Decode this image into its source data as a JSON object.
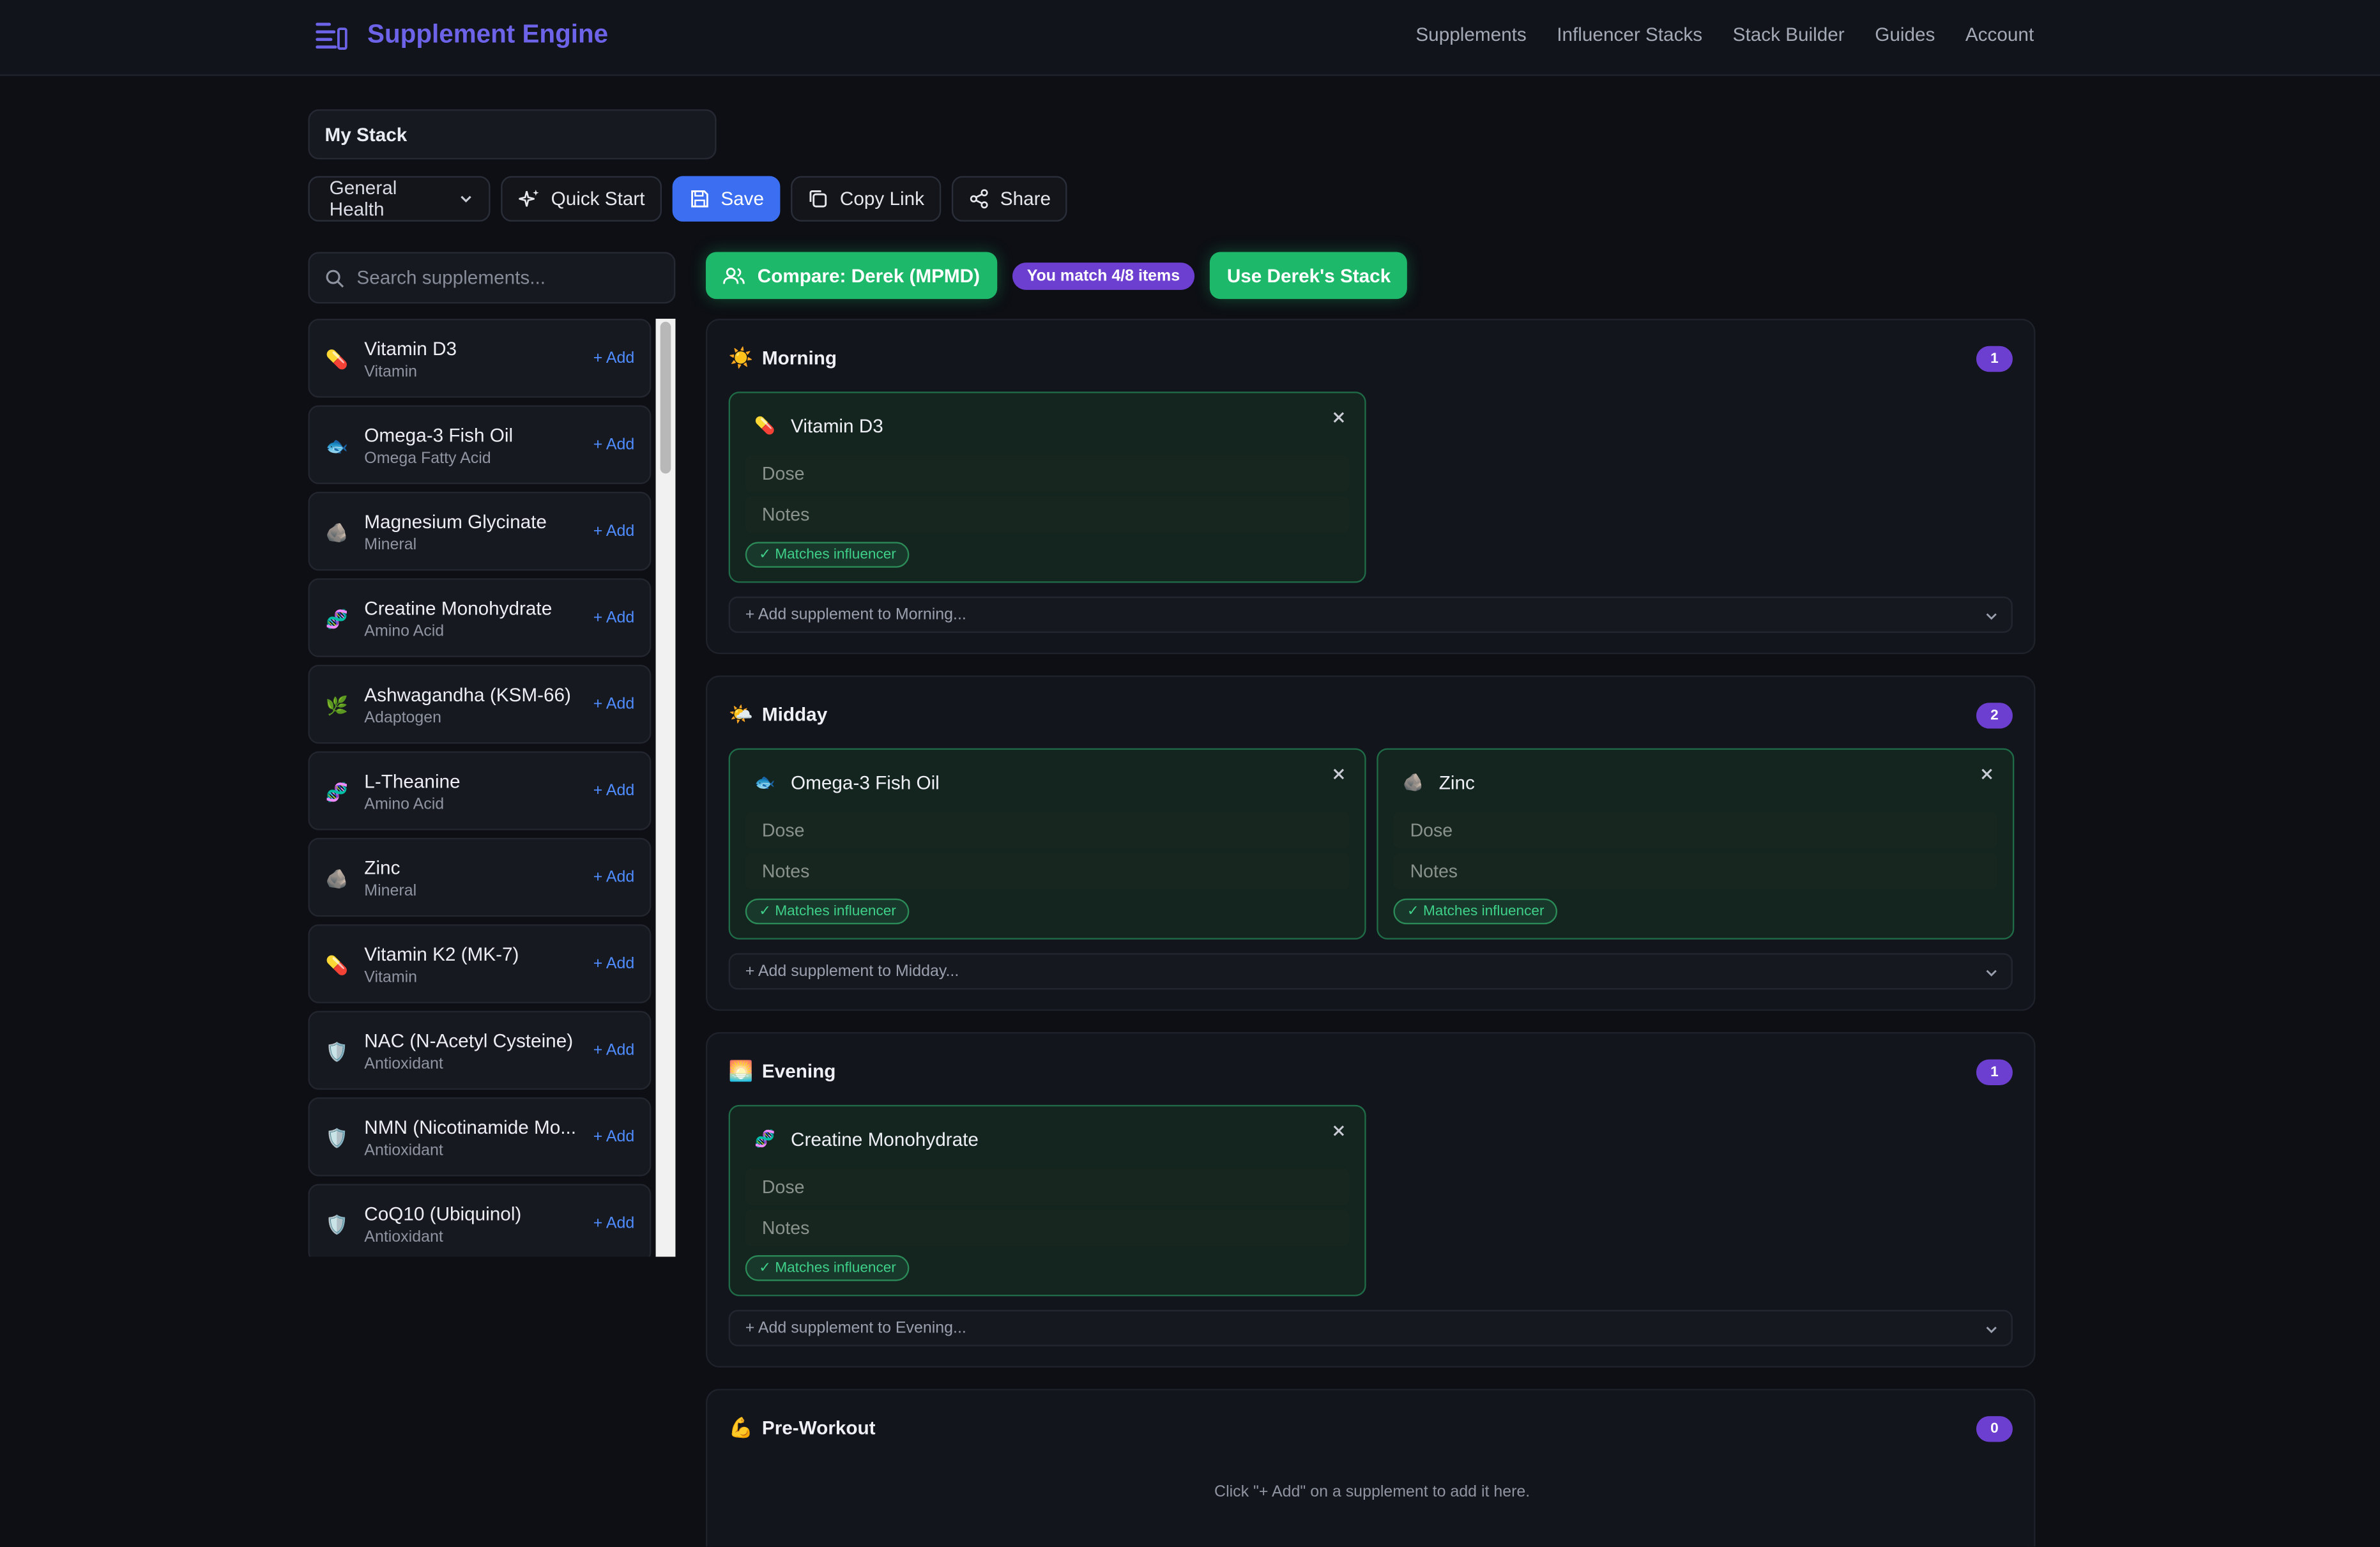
{
  "app": {
    "title": "Supplement Engine",
    "nav": [
      "Supplements",
      "Influencer Stacks",
      "Stack Builder",
      "Guides",
      "Account"
    ]
  },
  "stack": {
    "name": "My Stack",
    "goal": "General Health",
    "quick_start": "Quick Start",
    "save": "Save",
    "copy_link": "Copy Link",
    "share": "Share"
  },
  "search": {
    "placeholder": "Search supplements..."
  },
  "supplements": [
    {
      "name": "Vitamin D3",
      "category": "Vitamin",
      "icon": "pill-icon",
      "add": "+ Add"
    },
    {
      "name": "Omega-3 Fish Oil",
      "category": "Omega Fatty Acid",
      "icon": "fish-icon",
      "add": "+ Add"
    },
    {
      "name": "Magnesium Glycinate",
      "category": "Mineral",
      "icon": "rock-icon",
      "add": "+ Add"
    },
    {
      "name": "Creatine Monohydrate",
      "category": "Amino Acid",
      "icon": "dna-icon",
      "add": "+ Add"
    },
    {
      "name": "Ashwagandha (KSM-66)",
      "category": "Adaptogen",
      "icon": "herb-icon",
      "add": "+ Add"
    },
    {
      "name": "L-Theanine",
      "category": "Amino Acid",
      "icon": "dna-icon",
      "add": "+ Add"
    },
    {
      "name": "Zinc",
      "category": "Mineral",
      "icon": "rock-icon",
      "add": "+ Add"
    },
    {
      "name": "Vitamin K2 (MK-7)",
      "category": "Vitamin",
      "icon": "pill-icon",
      "add": "+ Add"
    },
    {
      "name": "NAC (N-Acetyl Cysteine)",
      "category": "Antioxidant",
      "icon": "shield-icon",
      "add": "+ Add"
    },
    {
      "name": "NMN (Nicotinamide Mo...",
      "category": "Antioxidant",
      "icon": "shield-icon",
      "add": "+ Add"
    },
    {
      "name": "CoQ10 (Ubiquinol)",
      "category": "Antioxidant",
      "icon": "shield-icon",
      "add": "+ Add"
    }
  ],
  "compare": {
    "label": "Compare: Derek (MPMD)",
    "match": "You match 4/8 items",
    "use": "Use Derek's Stack"
  },
  "sections": [
    {
      "title": "Morning",
      "icon": "sun-icon",
      "count": "1",
      "cards": [
        {
          "name": "Vitamin D3",
          "icon": "pill-icon",
          "dose": "Dose",
          "notes": "Notes",
          "badge": "✓ Matches influencer"
        }
      ],
      "add": "+ Add supplement to Morning..."
    },
    {
      "title": "Midday",
      "icon": "sun-cloud-icon",
      "count": "2",
      "cards": [
        {
          "name": "Omega-3 Fish Oil",
          "icon": "fish-icon",
          "dose": "Dose",
          "notes": "Notes",
          "badge": "✓ Matches influencer"
        },
        {
          "name": "Zinc",
          "icon": "rock-icon",
          "dose": "Dose",
          "notes": "Notes",
          "badge": "✓ Matches influencer"
        }
      ],
      "add": "+ Add supplement to Midday..."
    },
    {
      "title": "Evening",
      "icon": "sunset-icon",
      "count": "1",
      "cards": [
        {
          "name": "Creatine Monohydrate",
          "icon": "dna-icon",
          "dose": "Dose",
          "notes": "Notes",
          "badge": "✓ Matches influencer"
        }
      ],
      "add": "+ Add supplement to Evening..."
    },
    {
      "title": "Pre-Workout",
      "icon": "flexed-arm-icon",
      "count": "0",
      "cards": [],
      "empty": "Click \"+ Add\" on a supplement to add it here."
    }
  ],
  "colors": {
    "background": "#0d0f14",
    "brand": "#6c63e8",
    "primary": "#3b6ef0",
    "green": "#1eb86a",
    "purple": "#6c3fd0",
    "link": "#4f8cff"
  }
}
